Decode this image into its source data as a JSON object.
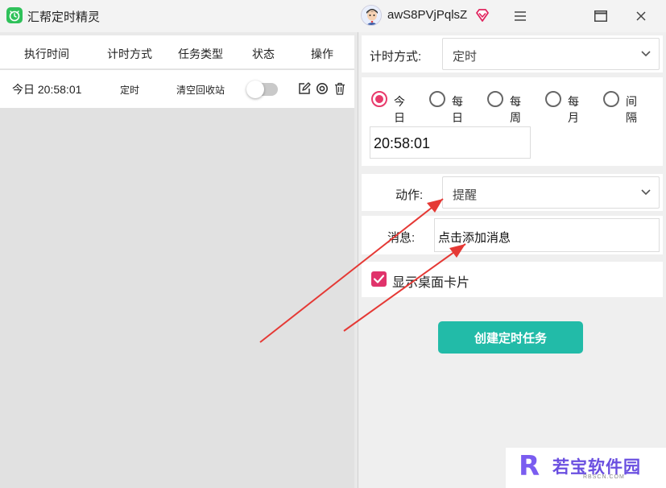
{
  "window": {
    "title": "汇帮定时精灵",
    "username": "awS8PVjPqlsZ",
    "icons": [
      "app-logo-icon",
      "avatar",
      "vip-diamond-icon",
      "menu-icon",
      "maximize-icon",
      "close-icon"
    ]
  },
  "task_table": {
    "columns": [
      "执行时间",
      "计时方式",
      "任务类型",
      "状态",
      "操作"
    ],
    "rows": [
      {
        "time": "今日 20:58:01",
        "timing": "定时",
        "task_type": "清空回收站",
        "enabled": false,
        "actions": [
          "edit-icon",
          "settings-icon",
          "delete-icon"
        ]
      }
    ]
  },
  "form": {
    "timing_label": "计时方式:",
    "timing_value": "定时",
    "repeat_options": [
      "今日",
      "每日",
      "每周",
      "每月",
      "间隔"
    ],
    "repeat_selected": "今日",
    "time_value": "20:58:01",
    "action_label": "动作:",
    "action_value": "提醒",
    "message_label": "消息:",
    "message_value": "点击添加消息",
    "show_card_label": "显示桌面卡片",
    "show_card_checked": true,
    "create_button": "创建定时任务"
  },
  "watermark": {
    "logo_letter": "R",
    "text": "若宝软件园",
    "sub": "RBSCN.COM"
  },
  "colors": {
    "accent_pink": "#e83a6b",
    "button_teal": "#22bba8",
    "annotation_red": "#e53935",
    "app_green": "#2fc15a"
  }
}
